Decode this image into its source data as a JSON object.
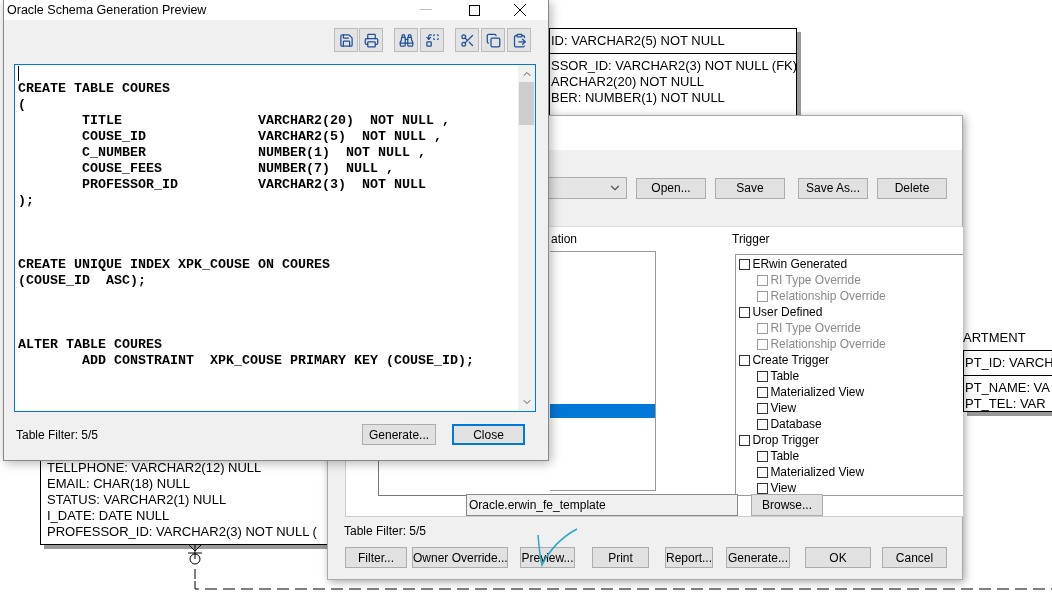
{
  "diagram": {
    "entities": [
      {
        "key_attributes": [
          "ID: VARCHAR2(5) NOT NULL"
        ],
        "attributes": [
          "SSOR_ID: VARCHAR2(3) NOT NULL (FK)",
          "ARCHAR2(20) NOT NULL",
          "BER: NUMBER(1) NOT NULL"
        ]
      },
      {
        "title": "ARTMENT",
        "key_attributes": [
          "PT_ID: VARCH"
        ],
        "attributes": [
          "PT_NAME: VA",
          "PT_TEL: VAR"
        ]
      },
      {
        "attributes": [
          "TELLPHONE: VARCHAR2(12) NULL",
          "EMAIL: CHAR(18) NULL",
          "STATUS: VARCHAR2(1) NULL",
          "I_DATE: DATE NULL",
          "PROFESSOR_ID: VARCHAR2(3) NOT NULL ("
        ]
      }
    ]
  },
  "options_dialog": {
    "toolbar_buttons": [
      "Open...",
      "Save",
      "Save As...",
      "Delete"
    ],
    "location_label": "ation",
    "location_rows": [
      {
        "selected": true
      }
    ],
    "trigger_label": "Trigger",
    "trigger_tree": [
      {
        "label": "ERwin Generated",
        "checked": false,
        "disabled": false,
        "children": [
          {
            "label": "RI Type Override",
            "checked": false,
            "disabled": true
          },
          {
            "label": "Relationship Override",
            "checked": false,
            "disabled": true
          }
        ]
      },
      {
        "label": "User Defined",
        "checked": false,
        "disabled": false,
        "children": [
          {
            "label": "RI Type Override",
            "checked": false,
            "disabled": true
          },
          {
            "label": "Relationship Override",
            "checked": false,
            "disabled": true
          }
        ]
      },
      {
        "label": "Create Trigger",
        "checked": false,
        "disabled": false,
        "children": [
          {
            "label": "Table",
            "checked": false,
            "disabled": false
          },
          {
            "label": "Materialized View",
            "checked": false,
            "disabled": false
          },
          {
            "label": "View",
            "checked": false,
            "disabled": false
          },
          {
            "label": "Database",
            "checked": false,
            "disabled": false
          }
        ]
      },
      {
        "label": "Drop Trigger",
        "checked": false,
        "disabled": false,
        "children": [
          {
            "label": "Table",
            "checked": false,
            "disabled": false
          },
          {
            "label": "Materialized View",
            "checked": false,
            "disabled": false
          },
          {
            "label": "View",
            "checked": false,
            "disabled": false
          }
        ]
      }
    ],
    "template_field": {
      "value": "Oracle.erwin_fe_template"
    },
    "browse_button": "Browse...",
    "table_filter": "Table Filter: 5/5",
    "buttons": [
      "Filter...",
      "Owner Override...",
      "Preview...",
      "Print",
      "Report...",
      "Generate...",
      "OK",
      "Cancel"
    ]
  },
  "preview_window": {
    "title": "Oracle Schema Generation Preview",
    "code": "CREATE TABLE COURES\n(\n        TITLE                 VARCHAR2(20)  NOT NULL ,\n        COUSE_ID              VARCHAR2(5)  NOT NULL ,\n        C_NUMBER              NUMBER(1)  NOT NULL ,\n        COUSE_FEES            NUMBER(7)  NULL ,\n        PROFESSOR_ID          VARCHAR2(3)  NOT NULL\n);\n\n\n\nCREATE UNIQUE INDEX XPK_COUSE ON COURES\n(COUSE_ID  ASC);\n\n\n\nALTER TABLE COURES\n        ADD CONSTRAINT  XPK_COUSE PRIMARY KEY (COUSE_ID);",
    "table_filter": "Table Filter: 5/5",
    "buttons": [
      {
        "label": "Generate...",
        "default": false
      },
      {
        "label": "Close",
        "default": true
      }
    ]
  }
}
